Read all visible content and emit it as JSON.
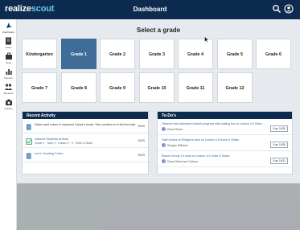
{
  "app": {
    "logo_part1": "realize",
    "logo_part2": "scout",
    "title": "Dashboard"
  },
  "header_icons": [
    "search-icon",
    "user-account-icon"
  ],
  "sidebar": {
    "items": [
      {
        "label": "Dashboard",
        "icon": "compass-icon",
        "active": true
      },
      {
        "label": "Notes",
        "icon": "notes-icon",
        "active": false
      },
      {
        "label": "Tools",
        "icon": "toolbox-icon",
        "active": false
      },
      {
        "label": "Reports",
        "icon": "bar-chart-icon",
        "active": false
      },
      {
        "label": "Students",
        "icon": "students-icon",
        "active": false
      },
      {
        "label": "Capture",
        "icon": "camera-icon",
        "active": false
      }
    ]
  },
  "grade_select": {
    "heading": "Select a grade",
    "selected": "Grade 1",
    "grades": [
      "Kindergarten",
      "Grade 1",
      "Grade 2",
      "Grade 3",
      "Grade 4",
      "Grade 5",
      "Grade 6",
      "Grade 7",
      "Grade 8",
      "Grade 9",
      "Grade 10",
      "Grade 11",
      "Grade 12"
    ]
  },
  "recent_activity": {
    "heading": "Recent Activity",
    "items": [
      {
        "icon": "document-icon",
        "line1": "Diane used cubes to represent Carlos's books. She counted on to find the total.",
        "line2": "",
        "date": "09/26"
      },
      {
        "icon": "checkbox-icon",
        "line1": "Observe Students at Work",
        "line2": "Grade 1 · Topic 3 · Lesson 4 · 3 · Solve & Share",
        "date": "09/26"
      },
      {
        "icon": "document-icon",
        "line1": "Lee's Counting Cubes",
        "line2": "",
        "date": "09/25"
      }
    ]
  },
  "todos": {
    "heading": "To-Do's",
    "items": [
      {
        "title": "Observe and document Diane's progress with making ten on Lesson 4-3 Solve ...",
        "who": "Diane Rahal",
        "due": "Due: 10/29"
      },
      {
        "title": "Take photos of Reegan's work on Lesson 4-5 Solve & Share.",
        "who": "Reegan Williams",
        "due": "Due: 10/29"
      },
      {
        "title": "Record Group 1's work on Lesson 4-3 Solve & Share.",
        "who": "Diane Rahal and Cothers",
        "due": "Due: 10/31"
      }
    ]
  },
  "colors": {
    "header": "#0d2b4f",
    "logo_accent": "#6cc4ea",
    "selected_tile": "#3f6d97",
    "background": "#e6eaee",
    "link": "#2a63a8"
  }
}
